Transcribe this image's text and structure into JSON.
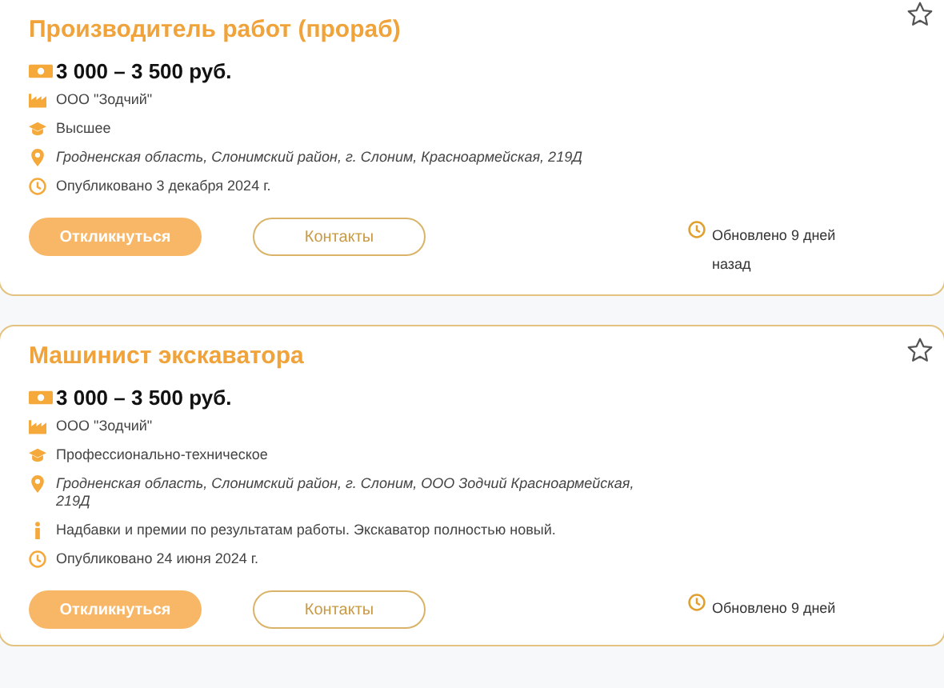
{
  "vacancies": [
    {
      "title": "Производитель работ (прораб)",
      "salary": "3 000 – 3 500 руб.",
      "favorite": false,
      "details": [
        {
          "kind": "company",
          "text": "ООО \"Зодчий\""
        },
        {
          "kind": "education",
          "text": "Высшее"
        },
        {
          "kind": "address",
          "text": "Гродненская область, Слонимский район, г. Слоним, Красноармейская, 219Д"
        },
        {
          "kind": "published",
          "text": "Опубликовано 3 декабря 2024 г."
        }
      ],
      "apply": "Откликнуться",
      "contacts": "Контакты",
      "updated": "Обновлено 9 дней назад"
    },
    {
      "title": "Машинист экскаватора",
      "salary": "3 000 – 3 500 руб.",
      "favorite": false,
      "details": [
        {
          "kind": "company",
          "text": "ООО \"Зодчий\""
        },
        {
          "kind": "education",
          "text": "Профессионально-техническое"
        },
        {
          "kind": "address",
          "text": "Гродненская область, Слонимский район, г. Слоним, ООО Зодчий Красноармейская, 219Д"
        },
        {
          "kind": "info",
          "text": "Надбавки и премии по результатам работы. Экскаватор полностью новый."
        },
        {
          "kind": "published",
          "text": "Опубликовано 24 июня 2024 г."
        }
      ],
      "apply": "Откликнуться",
      "contacts": "Контакты",
      "updated": "Обновлено 9 дней"
    }
  ]
}
